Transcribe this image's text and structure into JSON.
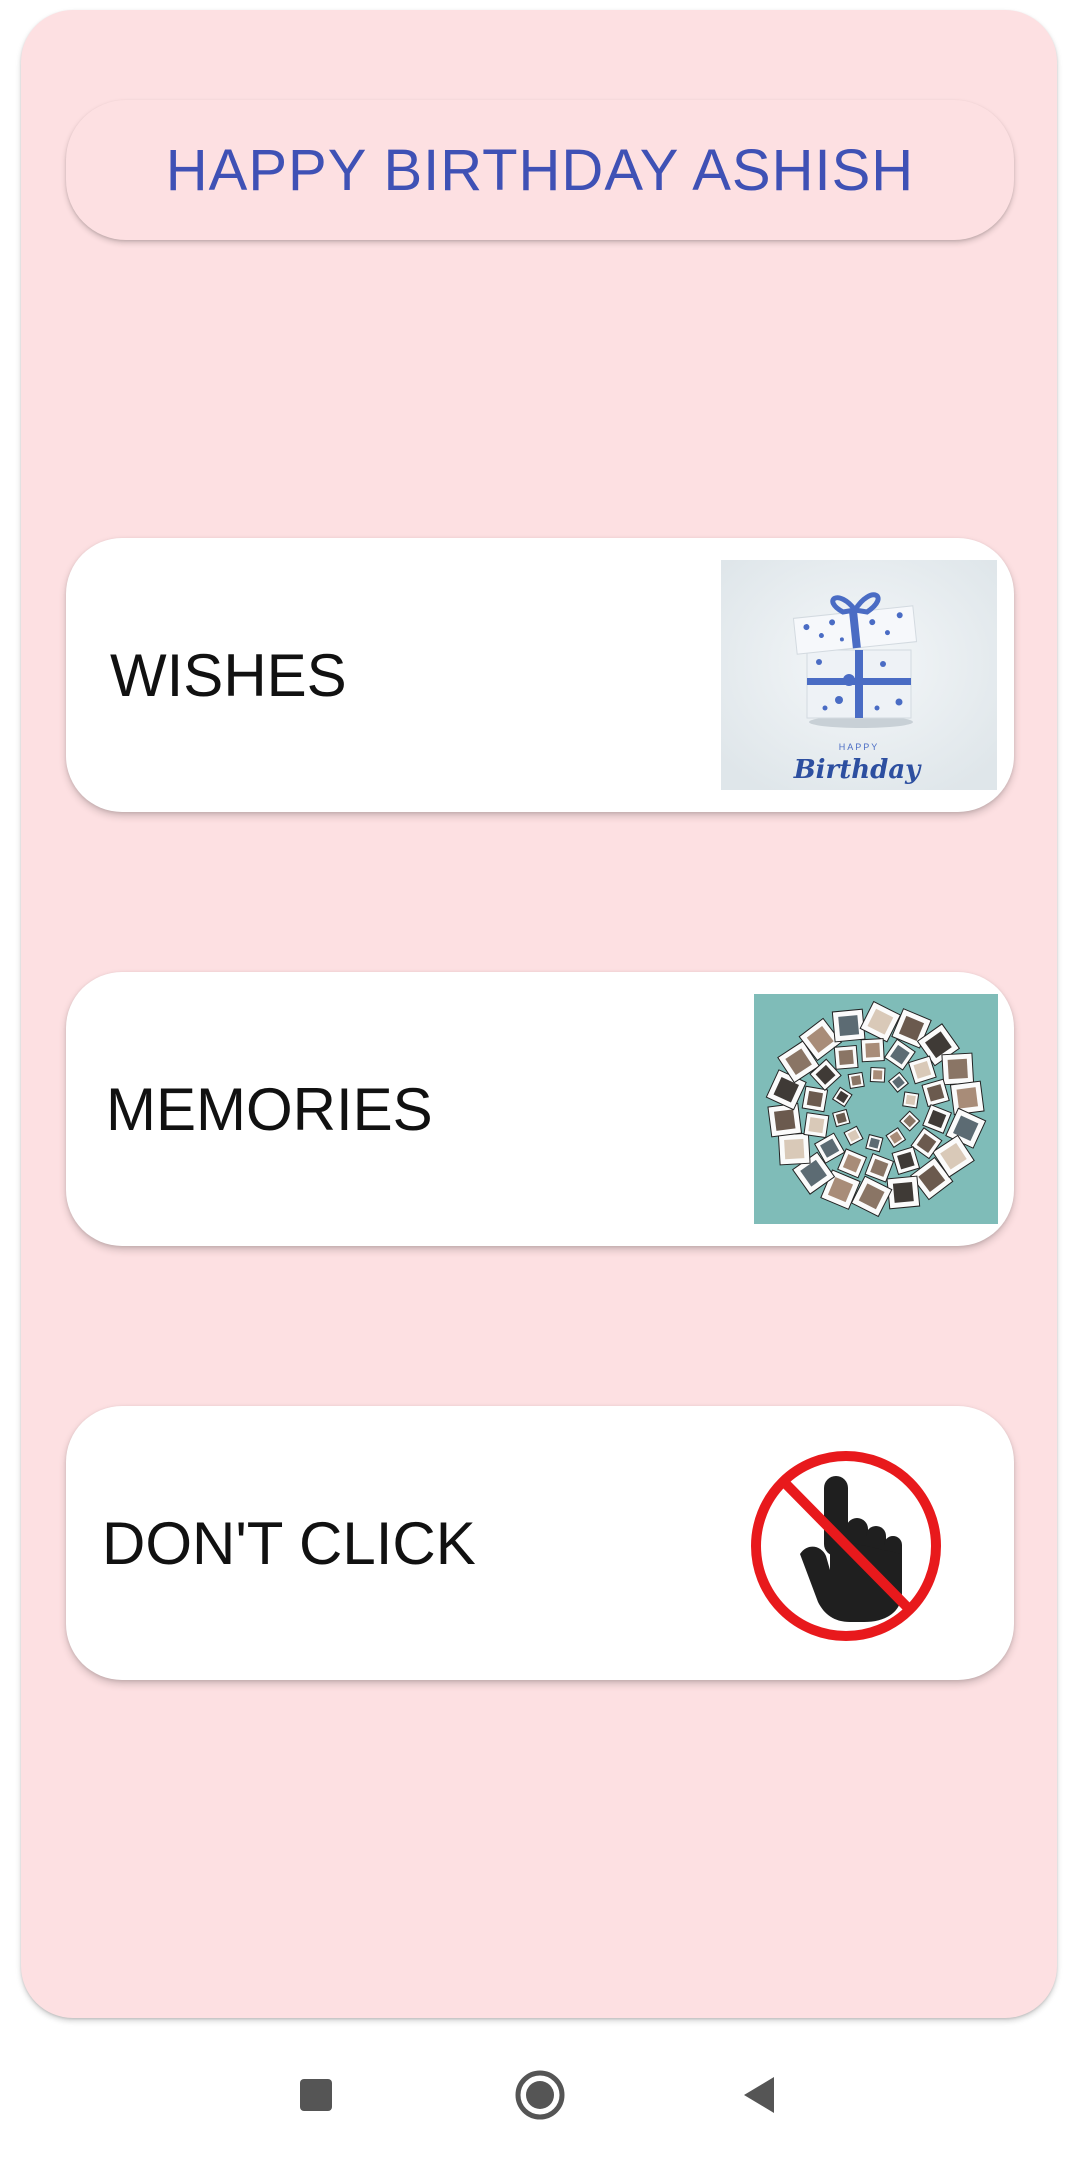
{
  "header": {
    "title": "HAPPY BIRTHDAY ASHISH"
  },
  "menu": [
    {
      "label": "WISHES",
      "thumb": "gift-box-birthday-image",
      "thumb_caption_small": "HAPPY",
      "thumb_caption_script": "Birthday"
    },
    {
      "label": "MEMORIES",
      "thumb": "photo-collage-wreath-image"
    },
    {
      "label": "DON'T CLICK",
      "thumb": "no-click-hand-icon"
    }
  ],
  "navbar": {
    "items": [
      "recent-apps",
      "home",
      "back"
    ]
  },
  "colors": {
    "background": "#fde0e2",
    "title": "#3f51b5",
    "card": "#ffffff",
    "gift_blue": "#4a6cc4",
    "collage_teal": "#7fbcb8",
    "no_sign_red": "#e8191c"
  }
}
